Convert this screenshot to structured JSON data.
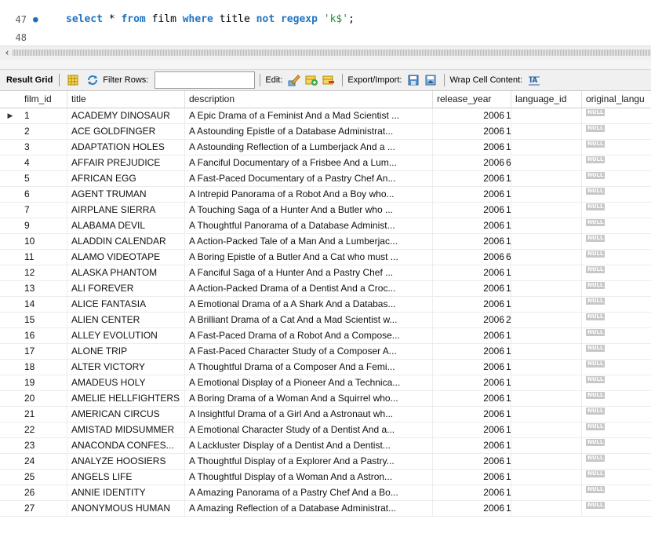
{
  "editor": {
    "lines": [
      {
        "num": "47",
        "bullet": "●",
        "parts": [
          {
            "t": "select",
            "c": "kw"
          },
          {
            "t": " * ",
            "c": "plain"
          },
          {
            "t": "from",
            "c": "kw"
          },
          {
            "t": " film ",
            "c": "plain"
          },
          {
            "t": "where",
            "c": "kw"
          },
          {
            "t": " title ",
            "c": "plain"
          },
          {
            "t": "not",
            "c": "kw"
          },
          {
            "t": " ",
            "c": "plain"
          },
          {
            "t": "regexp",
            "c": "kw"
          },
          {
            "t": " ",
            "c": "plain"
          },
          {
            "t": "'k$'",
            "c": "str"
          },
          {
            "t": ";",
            "c": "plain"
          }
        ]
      },
      {
        "num": "48",
        "bullet": "",
        "parts": []
      }
    ]
  },
  "toolbar": {
    "result_grid": "Result Grid",
    "filter_rows": "Filter Rows:",
    "filter_value": "",
    "edit": "Edit:",
    "export_import": "Export/Import:",
    "wrap": "Wrap Cell Content:"
  },
  "grid": {
    "columns": [
      "film_id",
      "title",
      "description",
      "release_year",
      "language_id",
      "original_langu"
    ],
    "null_label": "NULL",
    "rows": [
      [
        "1",
        "ACADEMY DINOSAUR",
        "A Epic Drama of a Feminist And a Mad Scientist ...",
        "2006",
        "1"
      ],
      [
        "2",
        "ACE GOLDFINGER",
        "A Astounding Epistle of a Database Administrat...",
        "2006",
        "1"
      ],
      [
        "3",
        "ADAPTATION HOLES",
        "A Astounding Reflection of a Lumberjack And a ...",
        "2006",
        "1"
      ],
      [
        "4",
        "AFFAIR PREJUDICE",
        "A Fanciful Documentary of a Frisbee And a Lum...",
        "2006",
        "6"
      ],
      [
        "5",
        "AFRICAN EGG",
        "A Fast-Paced Documentary of a Pastry Chef An...",
        "2006",
        "1"
      ],
      [
        "6",
        "AGENT TRUMAN",
        "A Intrepid Panorama of a Robot And a Boy who...",
        "2006",
        "1"
      ],
      [
        "7",
        "AIRPLANE SIERRA",
        "A Touching Saga of a Hunter And a Butler who ...",
        "2006",
        "1"
      ],
      [
        "9",
        "ALABAMA DEVIL",
        "A Thoughtful Panorama of a Database Administ...",
        "2006",
        "1"
      ],
      [
        "10",
        "ALADDIN CALENDAR",
        "A Action-Packed Tale of a Man And a Lumberjac...",
        "2006",
        "1"
      ],
      [
        "11",
        "ALAMO VIDEOTAPE",
        "A Boring Epistle of a Butler And a Cat who must ...",
        "2006",
        "6"
      ],
      [
        "12",
        "ALASKA PHANTOM",
        "A Fanciful Saga of a Hunter And a Pastry Chef ...",
        "2006",
        "1"
      ],
      [
        "13",
        "ALI FOREVER",
        "A Action-Packed Drama of a Dentist And a Croc...",
        "2006",
        "1"
      ],
      [
        "14",
        "ALICE FANTASIA",
        "A Emotional Drama of a A Shark And a Databas...",
        "2006",
        "1"
      ],
      [
        "15",
        "ALIEN CENTER",
        "A Brilliant Drama of a Cat And a Mad Scientist w...",
        "2006",
        "2"
      ],
      [
        "16",
        "ALLEY EVOLUTION",
        "A Fast-Paced Drama of a Robot And a Compose...",
        "2006",
        "1"
      ],
      [
        "17",
        "ALONE TRIP",
        "A Fast-Paced Character Study of a Composer A...",
        "2006",
        "1"
      ],
      [
        "18",
        "ALTER VICTORY",
        "A Thoughtful Drama of a Composer And a Femi...",
        "2006",
        "1"
      ],
      [
        "19",
        "AMADEUS HOLY",
        "A Emotional Display of a Pioneer And a Technica...",
        "2006",
        "1"
      ],
      [
        "20",
        "AMELIE HELLFIGHTERS",
        "A Boring Drama of a Woman And a Squirrel who...",
        "2006",
        "1"
      ],
      [
        "21",
        "AMERICAN CIRCUS",
        "A Insightful Drama of a Girl And a Astronaut wh...",
        "2006",
        "1"
      ],
      [
        "22",
        "AMISTAD MIDSUMMER",
        "A Emotional Character Study of a Dentist And a...",
        "2006",
        "1"
      ],
      [
        "23",
        "ANACONDA CONFES...",
        "A Lackluster Display of a Dentist And a Dentist...",
        "2006",
        "1"
      ],
      [
        "24",
        "ANALYZE HOOSIERS",
        "A Thoughtful Display of a Explorer And a Pastry...",
        "2006",
        "1"
      ],
      [
        "25",
        "ANGELS LIFE",
        "A Thoughtful Display of a Woman And a Astron...",
        "2006",
        "1"
      ],
      [
        "26",
        "ANNIE IDENTITY",
        "A Amazing Panorama of a Pastry Chef And a Bo...",
        "2006",
        "1"
      ],
      [
        "27",
        "ANONYMOUS HUMAN",
        "A Amazing Reflection of a Database Administrat...",
        "2006",
        "1"
      ]
    ]
  },
  "icons": {
    "row_marker": "row-pointer-icon",
    "grid": "grid-icon",
    "refresh": "refresh-icon",
    "edit": "edit-pencil-icon",
    "add_row": "add-row-icon",
    "delete_row": "delete-row-icon",
    "export": "export-icon",
    "import": "import-icon",
    "wrap": "wrap-cell-icon"
  }
}
